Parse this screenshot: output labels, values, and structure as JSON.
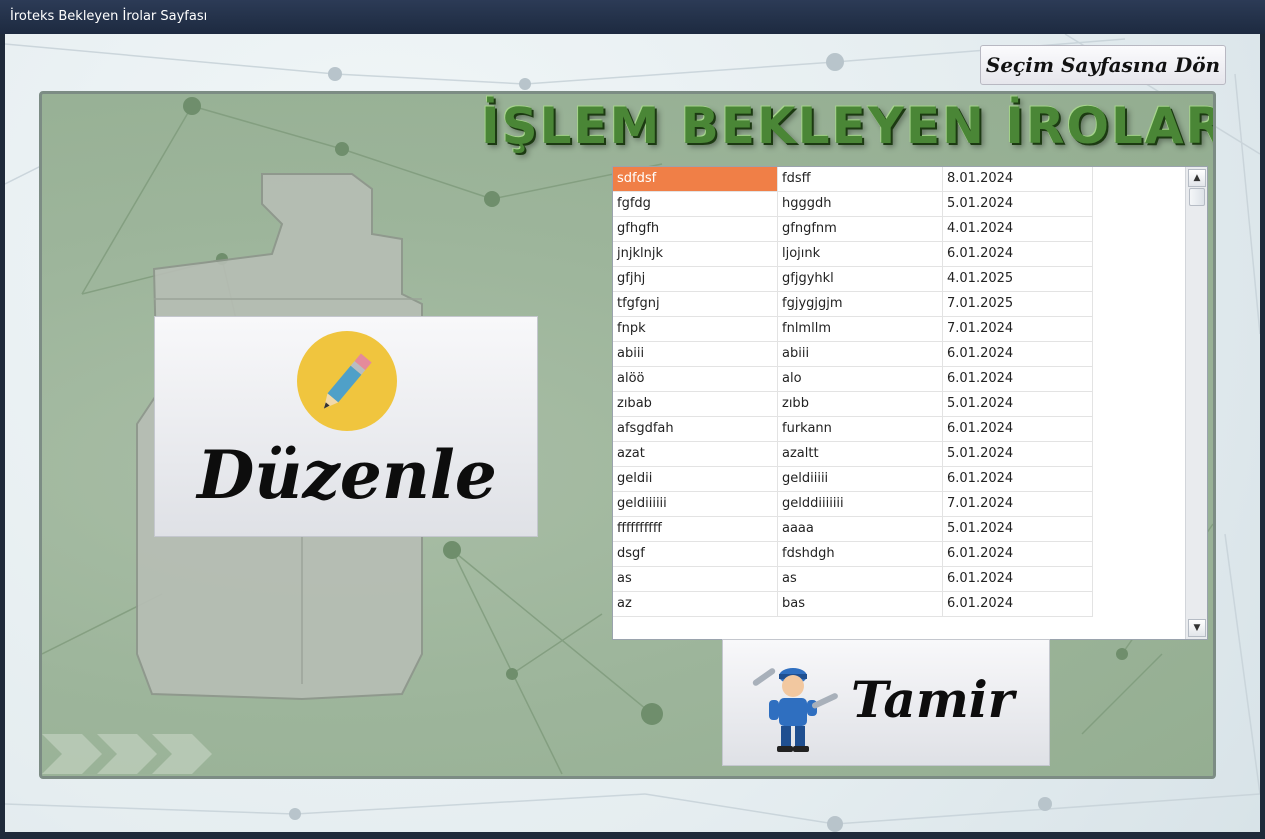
{
  "window": {
    "title": "İroteks Bekleyen İrolar Sayfası"
  },
  "back_button": {
    "label": "Seçim Sayfasına Dön"
  },
  "page_heading": "İŞLEM BEKLEYEN İROLAR",
  "edit_button": {
    "label": "Düzenle",
    "icon": "pencil-icon"
  },
  "repair_button": {
    "label": "Tamir",
    "icon": "mechanic-icon"
  },
  "colors": {
    "selection": "#f07f47",
    "heading": "#4a8636",
    "panel": "#9db59b",
    "titlebar": "#1d2a40"
  },
  "table": {
    "selected_row": 0,
    "rows": [
      [
        "sdfdsf",
        "fdsff",
        "8.01.2024"
      ],
      [
        "fgfdg",
        "hgggdh",
        "5.01.2024"
      ],
      [
        "gfhgfh",
        "gfngfnm",
        "4.01.2024"
      ],
      [
        "jnjklnjk",
        "ljojınk",
        "6.01.2024"
      ],
      [
        "gfjhj",
        "gfjgyhkl",
        "4.01.2025"
      ],
      [
        "tfgfgnj",
        "fgjygjgjm",
        "7.01.2025"
      ],
      [
        "fnpk",
        "fnlmllm",
        "7.01.2024"
      ],
      [
        "abiii",
        "abiii",
        "6.01.2024"
      ],
      [
        "alöö",
        "alo",
        "6.01.2024"
      ],
      [
        "zıbab",
        "zıbb",
        "5.01.2024"
      ],
      [
        "afsgdfah",
        "furkann",
        "6.01.2024"
      ],
      [
        "azat",
        "azaltt",
        "5.01.2024"
      ],
      [
        "geldii",
        "geldiiiii",
        "6.01.2024"
      ],
      [
        "geldiiiiii",
        "gelddiiiiiii",
        "7.01.2024"
      ],
      [
        "ffffffffff",
        "aaaa",
        "5.01.2024"
      ],
      [
        "dsgf",
        "fdshdgh",
        "6.01.2024"
      ],
      [
        "as",
        "as",
        "6.01.2024"
      ],
      [
        "az",
        "bas",
        "6.01.2024"
      ]
    ]
  }
}
